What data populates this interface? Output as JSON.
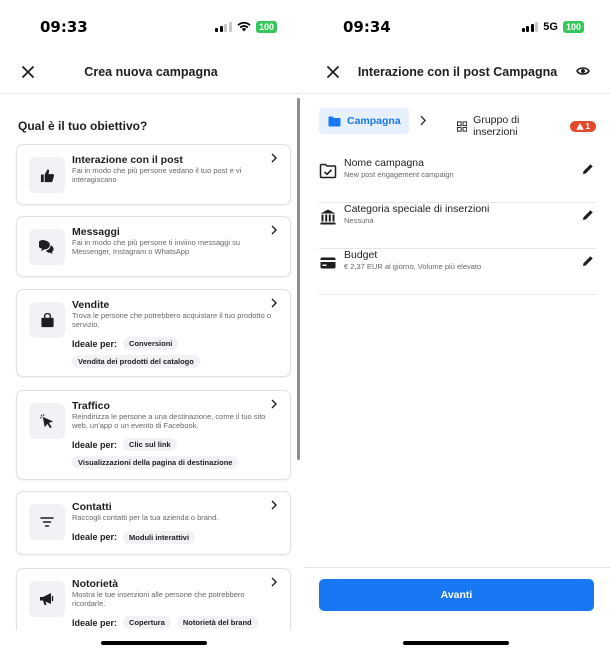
{
  "left": {
    "status": {
      "time": "09:33",
      "battery": "100"
    },
    "nav": {
      "title": "Crea nuova campagna"
    },
    "question": "Qual è il tuo obiettivo?",
    "ideal_label": "Ideale per:",
    "objectives": [
      {
        "title": "Interazione con il post",
        "desc": "Fai in modo che più persone vedano il tuo post e vi interagiscano",
        "icon": "thumbs-up-icon"
      },
      {
        "title": "Messaggi",
        "desc": "Fai in modo che più persone ti inviino messaggi su Messenger, Instagram o WhatsApp",
        "icon": "chat-bubbles-icon"
      },
      {
        "title": "Vendite",
        "desc": "Trova le persone che potrebbero acquistare il tuo prodotto o servizio.",
        "icon": "shopping-bag-icon",
        "ideal": [
          "Conversioni",
          "Vendita dei prodotti del catalogo"
        ]
      },
      {
        "title": "Traffico",
        "desc": "Reindirizza le persone a una destinazione, come il tuo sito web, un'app o un evento di Facebook.",
        "icon": "cursor-click-icon",
        "ideal": [
          "Clic sul link",
          "Visualizzazioni della pagina di destinazione"
        ]
      },
      {
        "title": "Contatti",
        "desc": "Raccogli contatti per la tua azienda o brand.",
        "icon": "filter-icon",
        "ideal": [
          "Moduli interattivi"
        ]
      },
      {
        "title": "Notorietà",
        "desc": "Mostra le tue inserzioni alle persone che potrebbero ricordarle.",
        "icon": "megaphone-icon",
        "ideal": [
          "Copertura",
          "Notorietà del brand"
        ]
      }
    ]
  },
  "right": {
    "status": {
      "time": "09:34",
      "network": "5G",
      "battery": "100"
    },
    "nav": {
      "title": "Interazione con il post Campagna"
    },
    "breadcrumb": {
      "active": "Campagna",
      "next": "Gruppo di inserzioni",
      "warning_count": "1"
    },
    "settings": [
      {
        "title": "Nome campagna",
        "sub": "New post engagement campaign",
        "icon": "folder-check-icon"
      },
      {
        "title": "Categoria speciale di inserzioni",
        "sub": "Nessuna",
        "icon": "bank-icon"
      },
      {
        "title": "Budget",
        "sub": "€ 2,37 EUR al giorno, Volume più elevato",
        "icon": "credit-card-icon"
      }
    ],
    "primary_button": "Avanti"
  },
  "colors": {
    "accent": "#1877f2",
    "warning": "#e14a2b",
    "battery": "#34c759"
  }
}
